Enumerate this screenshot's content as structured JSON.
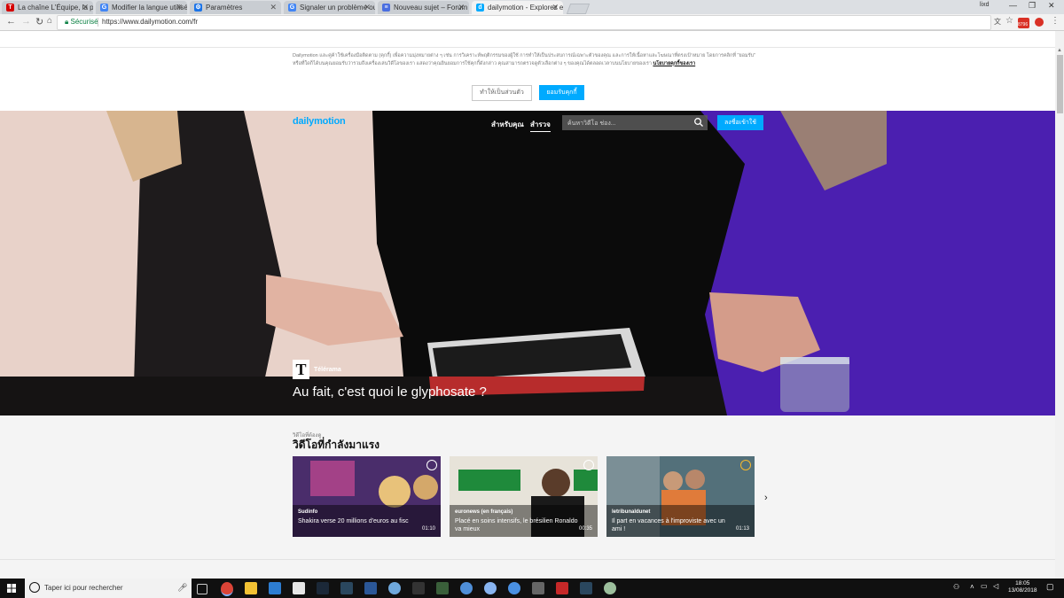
{
  "browser": {
    "tabs": [
      {
        "title": "La chaîne L'Équipe, la pre",
        "favicon": "lequipe-icon",
        "color": "#d50000"
      },
      {
        "title": "Modifier la langue utilisé",
        "favicon": "google-icon",
        "color": "#4285f4"
      },
      {
        "title": "Paramètres",
        "favicon": "settings-icon",
        "color": "#1a73e8"
      },
      {
        "title": "Signaler un problème ou",
        "favicon": "google-icon",
        "color": "#4285f4"
      },
      {
        "title": "Nouveau sujet – Forum C",
        "favicon": "forum-icon",
        "color": "#4a6ee0"
      },
      {
        "title": "dailymotion - Explorez et",
        "favicon": "dailymotion-icon",
        "color": "#00aaff"
      }
    ],
    "profile_label": "lixd",
    "secure_label": "Sécurisé",
    "url": "https://www.dailymotion.com/fr",
    "gmail_badge": "8796"
  },
  "cookie": {
    "text": "Dailymotion และคู่ค้าใช้เครื่องมือติดตาม (คุกกี้) เพื่อความมุ่งหมายต่าง ๆ เช่น การวิเคราะห์พฤติกรรมของผู้ใช้ การทำให้เป็นประสบการณ์เฉพาะตัวของคุณ และการให้เนื้อหาและโฆษณาที่ตรงเป้าหมาย โดยการคลิกที่ \"ยอมรับ\" หรือที่ใดก็ได้บนคุณยอมรับว่ารวมถึงเครื่องเล่นวิดีโอของเรา แสดงว่าคุณยินยอมการใช้คุกกี้ดังกล่าว คุณสามารถตรวจดูตัวเลือกต่าง ๆ ของคุณได้ตลอดเวลาบนนโยบายของเรา",
    "policy_link": "นโยบายคุกกี้ของเรา",
    "personalize_label": "ทำให้เป็นส่วนตัว",
    "accept_label": "ยอมรับคุกกี้"
  },
  "header": {
    "logo": "dailymotion",
    "nav_for_you": "สำหรับคุณ",
    "nav_explore": "สำรวจ",
    "search_placeholder": "ค้นหาวิดีโอ ช่อง...",
    "signup_label": "ลงชื่อเข้าใช้"
  },
  "hero": {
    "channel_logo": "T",
    "channel": "Télérama",
    "title": "Au fait, c'est quoi le glyphosate ?"
  },
  "trending": {
    "subtitle": "วิดีโอที่ต้องดู",
    "title": "วิดีโอที่กำลังมาแรง",
    "cards": [
      {
        "channel": "Sudinfo",
        "title": "Shakira verse 20 millions d'euros au fisc",
        "duration": "01:10",
        "bg": "#5c3a7a"
      },
      {
        "channel": "euronews (en français)",
        "title": "Placé en soins intensifs, le brésilien Ronaldo va mieux",
        "duration": "00:35",
        "bg": "#d9d4c8"
      },
      {
        "channel": "letribunaldunet",
        "title": "Il part en vacances à l'improviste avec un ami !",
        "duration": "01:13",
        "bg": "#4d6670"
      }
    ]
  },
  "taskbar": {
    "search_text": "Taper ici pour rechercher",
    "time": "18:05",
    "date": "13/08/2018"
  }
}
